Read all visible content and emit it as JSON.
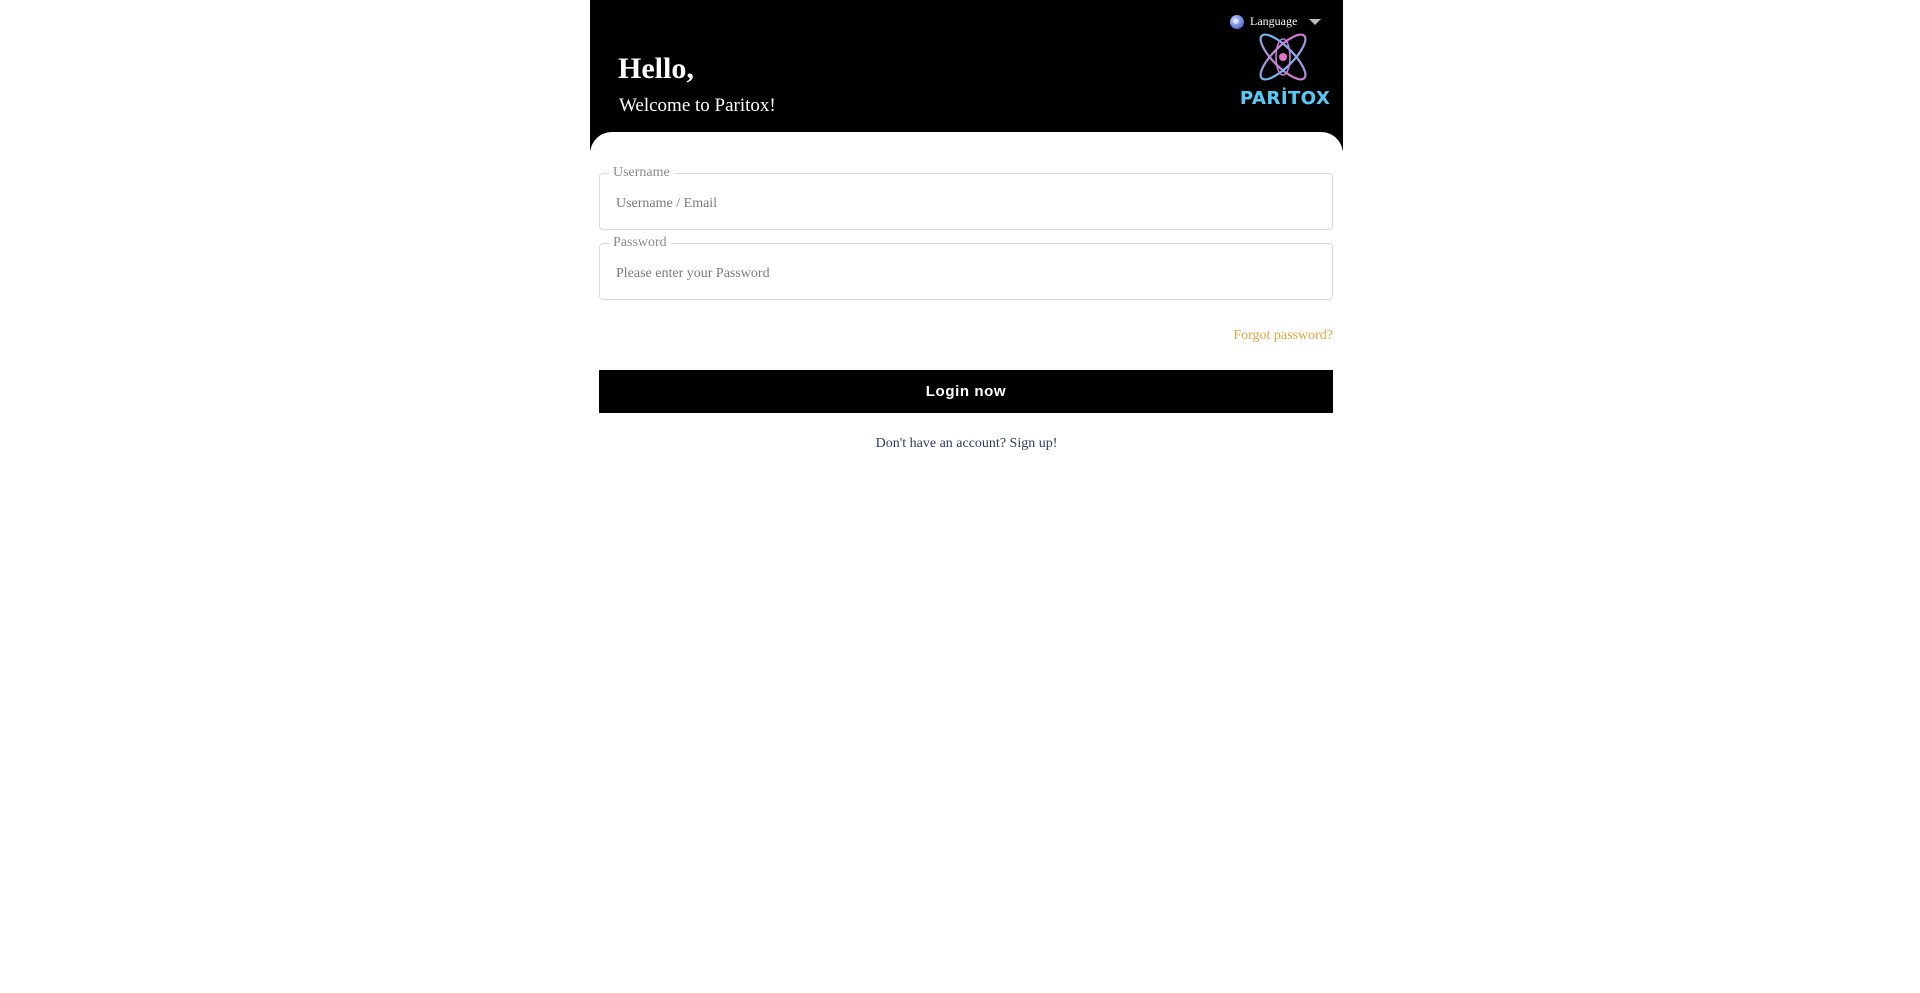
{
  "header": {
    "language_label": "Language",
    "greeting": "Hello,",
    "welcome": "Welcome to Paritox!",
    "logo_text": "PARİTOX"
  },
  "form": {
    "username_label": "Username",
    "username_placeholder": "Username / Email",
    "password_label": "Password",
    "password_placeholder": "Please enter your Password",
    "forgot_label": "Forgot password?",
    "login_label": "Login now",
    "signup_label": "Don't have an account? Sign up!"
  },
  "icons": {
    "language": "globe-icon",
    "dropdown": "chevron-down-icon",
    "logo": "atom-logo-icon"
  },
  "colors": {
    "header_bg": "#000000",
    "accent_forgot": "#e6a23c",
    "button_bg": "#000000",
    "logo_cyan": "#5ac8f5",
    "logo_pink": "#e26fc8"
  }
}
